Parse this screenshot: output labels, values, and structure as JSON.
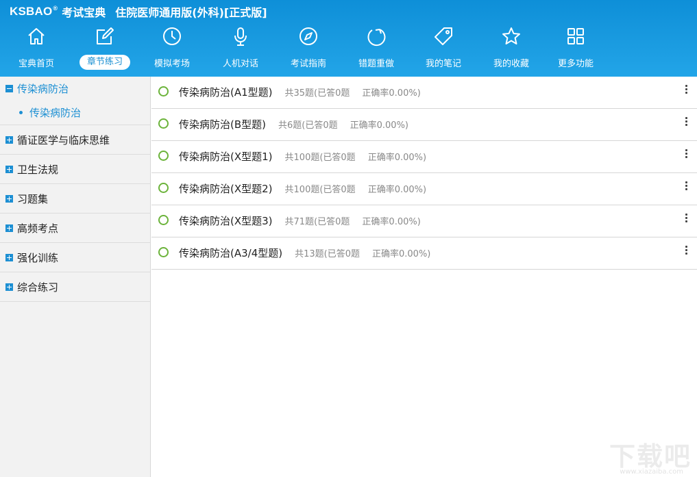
{
  "app": {
    "brand_en": "KSBAO",
    "brand_reg": "®",
    "brand_cn": "考试宝典",
    "edition": "住院医师通用版(外科)[正式版]"
  },
  "nav": {
    "items": [
      {
        "label": "宝典首页",
        "icon": "home-icon"
      },
      {
        "label": "章节练习",
        "icon": "edit-icon",
        "active": true
      },
      {
        "label": "模拟考场",
        "icon": "clock-icon"
      },
      {
        "label": "人机对话",
        "icon": "microphone-icon"
      },
      {
        "label": "考试指南",
        "icon": "compass-icon"
      },
      {
        "label": "错题重做",
        "icon": "refresh-icon"
      },
      {
        "label": "我的笔记",
        "icon": "tag-icon"
      },
      {
        "label": "我的收藏",
        "icon": "star-icon"
      },
      {
        "label": "更多功能",
        "icon": "grid-icon"
      }
    ]
  },
  "sidebar": {
    "items": [
      {
        "label": "传染病防治",
        "expanded": true,
        "children": [
          {
            "label": "传染病防治"
          }
        ]
      },
      {
        "label": "循证医学与临床思维"
      },
      {
        "label": "卫生法规"
      },
      {
        "label": "习题集"
      },
      {
        "label": "高频考点"
      },
      {
        "label": "强化训练"
      },
      {
        "label": "综合练习"
      }
    ]
  },
  "list": {
    "rows": [
      {
        "title": "传染病防治(A1型题)",
        "count": "共35题(已答0题",
        "accuracy": "正确率0.00%)"
      },
      {
        "title": "传染病防治(B型题)",
        "count": "共6题(已答0题",
        "accuracy": "正确率0.00%)"
      },
      {
        "title": "传染病防治(X型题1)",
        "count": "共100题(已答0题",
        "accuracy": "正确率0.00%)"
      },
      {
        "title": "传染病防治(X型题2)",
        "count": "共100题(已答0题",
        "accuracy": "正确率0.00%)"
      },
      {
        "title": "传染病防治(X型题3)",
        "count": "共71题(已答0题",
        "accuracy": "正确率0.00%)"
      },
      {
        "title": "传染病防治(A3/4型题)",
        "count": "共13题(已答0题",
        "accuracy": "正确率0.00%)"
      }
    ]
  },
  "watermark": {
    "main": "下载吧",
    "sub": "www.xiazaiba.com"
  },
  "colors": {
    "header": "#1a9be0",
    "accent": "#1c8fd3",
    "circle": "#6bb33a"
  }
}
